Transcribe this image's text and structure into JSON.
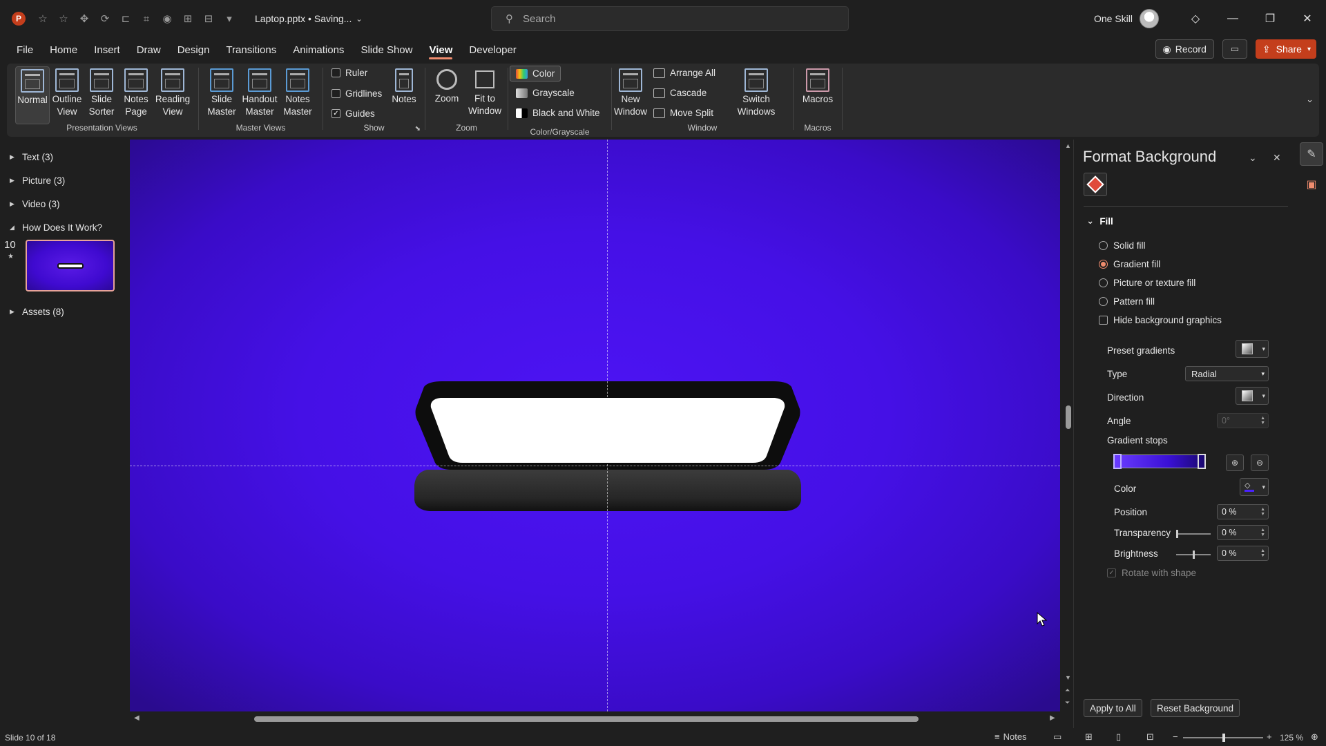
{
  "titlebar": {
    "app_logo": "P",
    "file_title": "Laptop.pptx • Saving...",
    "search_placeholder": "Search",
    "user_name": "One Skill",
    "qat_icons": [
      "autosave-icon",
      "favorite-icon",
      "touch-mode-icon",
      "redo-icon",
      "align-icon",
      "crop-icon",
      "shape-fill-icon",
      "arrange-icon",
      "distribute-icon",
      "customize-qat-icon"
    ]
  },
  "menu": {
    "items": [
      "File",
      "Home",
      "Insert",
      "Draw",
      "Design",
      "Transitions",
      "Animations",
      "Slide Show",
      "View",
      "Developer"
    ],
    "active": "View",
    "record_label": "Record",
    "share_label": "Share"
  },
  "ribbon": {
    "presentation_views": {
      "label": "Presentation Views",
      "buttons": [
        {
          "line1": "Normal",
          "line2": ""
        },
        {
          "line1": "Outline",
          "line2": "View"
        },
        {
          "line1": "Slide",
          "line2": "Sorter"
        },
        {
          "line1": "Notes",
          "line2": "Page"
        },
        {
          "line1": "Reading",
          "line2": "View"
        }
      ]
    },
    "master_views": {
      "label": "Master Views",
      "buttons": [
        {
          "line1": "Slide",
          "line2": "Master"
        },
        {
          "line1": "Handout",
          "line2": "Master"
        },
        {
          "line1": "Notes",
          "line2": "Master"
        }
      ]
    },
    "show": {
      "label": "Show",
      "ruler": "Ruler",
      "gridlines": "Gridlines",
      "guides": "Guides",
      "notes": "Notes",
      "ruler_checked": false,
      "gridlines_checked": false,
      "guides_checked": true
    },
    "zoom": {
      "label": "Zoom",
      "zoom_btn": "Zoom",
      "fit_line1": "Fit to",
      "fit_line2": "Window"
    },
    "color_grayscale": {
      "label": "Color/Grayscale",
      "color": "Color",
      "grayscale": "Grayscale",
      "bw": "Black and White"
    },
    "window": {
      "label": "Window",
      "new_line1": "New",
      "new_line2": "Window",
      "arrange_all": "Arrange All",
      "cascade": "Cascade",
      "move_split": "Move Split",
      "switch_line1": "Switch",
      "switch_line2": "Windows"
    },
    "macros": {
      "label": "Macros",
      "btn": "Macros"
    }
  },
  "left_panel": {
    "sections": [
      "Text (3)",
      "Picture (3)",
      "Video (3)",
      "How Does It Work?",
      "Assets (8)"
    ],
    "slide_number": "10",
    "slide_star": "★"
  },
  "format_pane": {
    "title": "Format Background",
    "fill_header": "Fill",
    "fill_options": [
      "Solid fill",
      "Gradient fill",
      "Picture or texture fill",
      "Pattern fill"
    ],
    "selected_fill": "Gradient fill",
    "hide_bg": "Hide background graphics",
    "preset_gradients": "Preset gradients",
    "type_label": "Type",
    "type_value": "Radial",
    "direction_label": "Direction",
    "angle_label": "Angle",
    "angle_value": "0°",
    "gradient_stops": "Gradient stops",
    "color_label": "Color",
    "position_label": "Position",
    "position_value": "0 %",
    "transparency_label": "Transparency",
    "transparency_value": "0 %",
    "brightness_label": "Brightness",
    "brightness_value": "0 %",
    "rotate_label": "Rotate with shape",
    "apply_all": "Apply to All",
    "reset_bg": "Reset Background",
    "stop_color": "#4a22ff"
  },
  "status": {
    "slide_info": "Slide 10 of 18",
    "notes": "Notes",
    "zoom": "125 %"
  },
  "colors": {
    "accent": "#c43e1c",
    "active_tab_underline": "#f08c6e",
    "slide_bg_center": "#4d14f4",
    "slide_bg_edge": "#2a0b8e"
  }
}
